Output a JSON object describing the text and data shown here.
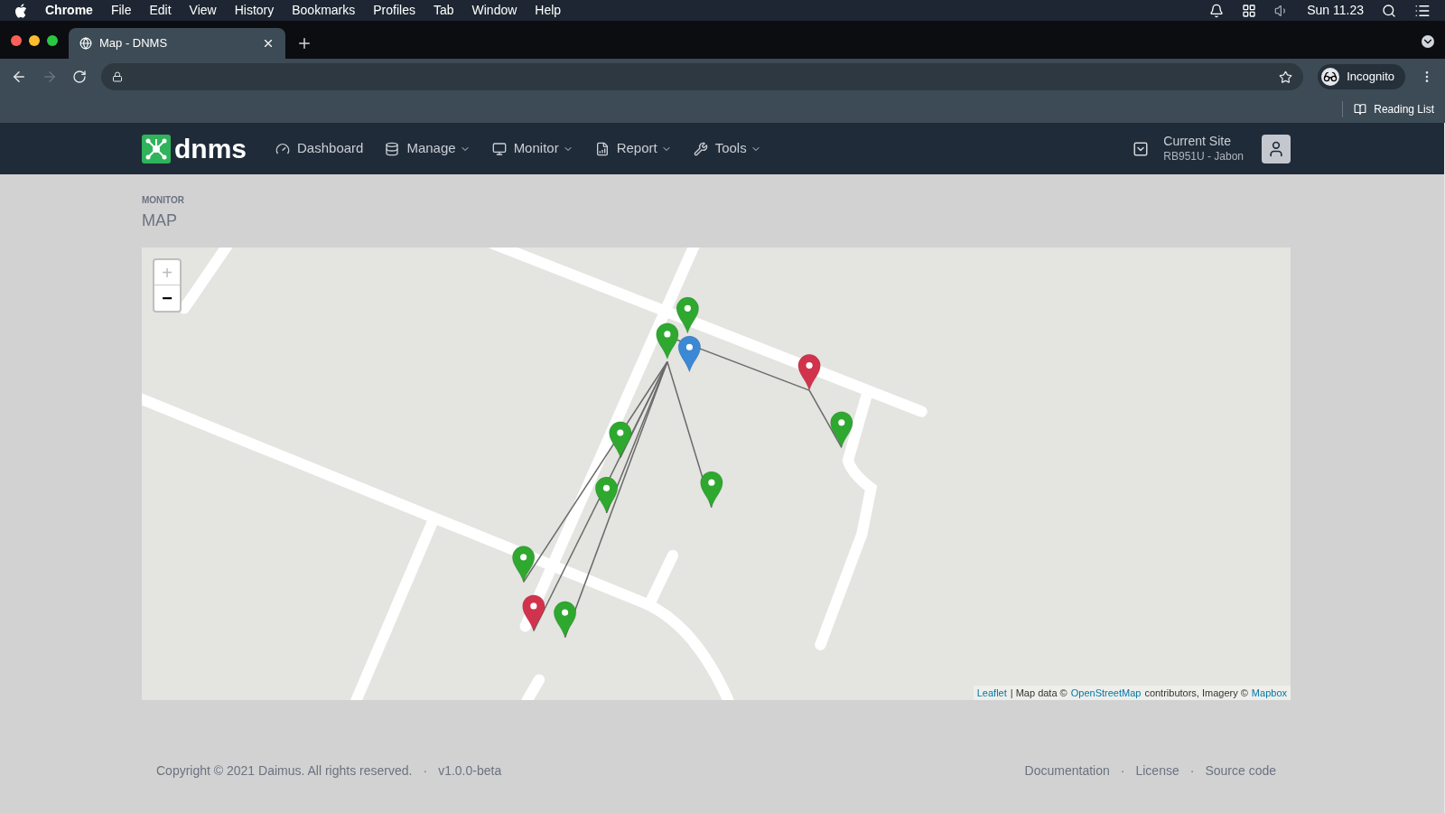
{
  "menu_bar": {
    "app": "Chrome",
    "items": [
      "File",
      "Edit",
      "View",
      "History",
      "Bookmarks",
      "Profiles",
      "Tab",
      "Window",
      "Help"
    ],
    "clock": "Sun 11.23"
  },
  "browser": {
    "tab_title": "Map - DNMS",
    "profile": "Incognito",
    "reading_list": "Reading List"
  },
  "app_nav": {
    "logo": "dnms",
    "items": [
      {
        "label": "Dashboard",
        "kind": "link"
      },
      {
        "label": "Manage",
        "kind": "dropdown"
      },
      {
        "label": "Monitor",
        "kind": "dropdown"
      },
      {
        "label": "Report",
        "kind": "dropdown"
      },
      {
        "label": "Tools",
        "kind": "dropdown"
      }
    ],
    "site_label": "Current Site",
    "site_value": "RB951U - Jabon"
  },
  "page": {
    "breadcrumb": "MONITOR",
    "title": "MAP"
  },
  "map": {
    "zoom_in": "+",
    "zoom_out": "−",
    "markers": [
      {
        "color": "#2ea82e"
      },
      {
        "color": "#2ea82e"
      },
      {
        "color": "#3b88d4"
      },
      {
        "color": "#d2334c"
      },
      {
        "color": "#2ea82e"
      },
      {
        "color": "#2ea82e"
      },
      {
        "color": "#2ea82e"
      },
      {
        "color": "#2ea82e"
      },
      {
        "color": "#2ea82e"
      },
      {
        "color": "#d2334c"
      },
      {
        "color": "#2ea82e"
      }
    ],
    "attribution": {
      "link_1": "Leaflet",
      "text_1": "| Map data ©",
      "link_2": "OpenStreetMap",
      "text_2": "contributors, Imagery ©",
      "link_3": "Mapbox"
    }
  },
  "footer": {
    "copyright": "Copyright © 2021 Daimus. All rights reserved.",
    "separator": "·",
    "version": "v1.0.0-beta",
    "links": [
      "Documentation",
      "License",
      "Source code"
    ]
  }
}
